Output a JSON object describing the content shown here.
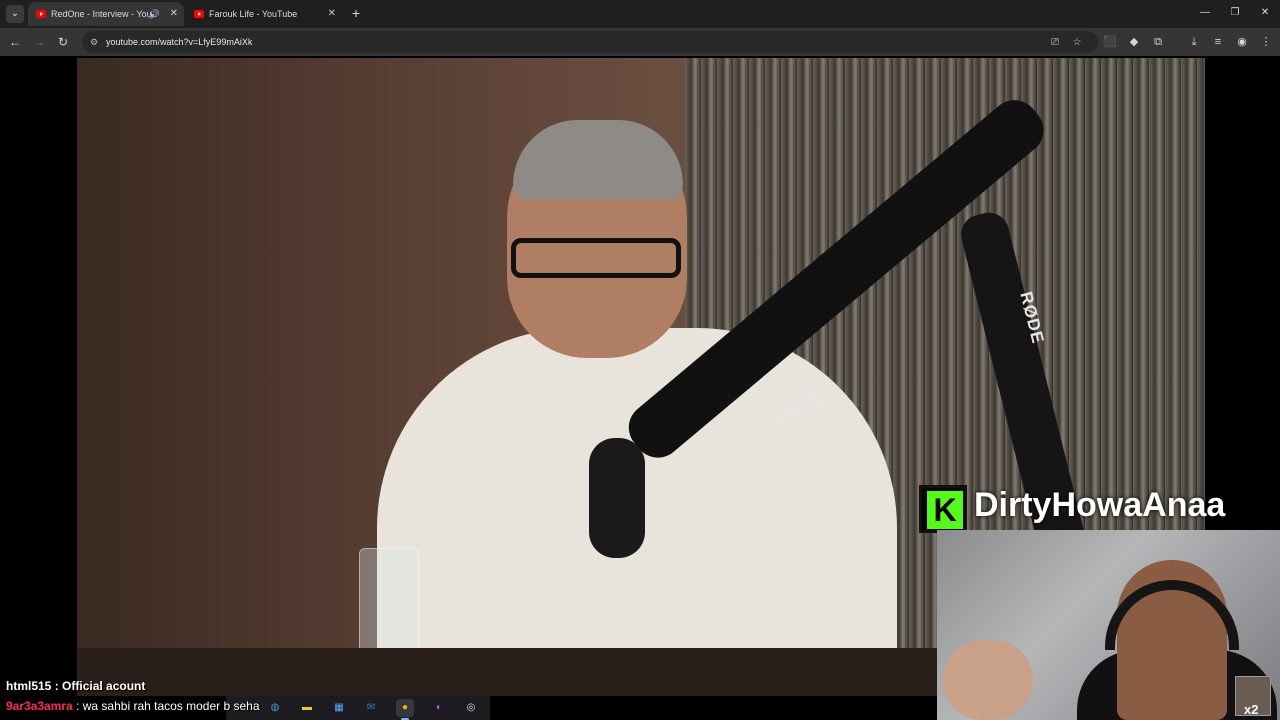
{
  "browser": {
    "tabs": [
      {
        "title": "RedOne - Interview - YouTube",
        "active": true,
        "audio_icon": "speaker-icon"
      },
      {
        "title": "Farouk Life - YouTube",
        "active": false
      }
    ],
    "tab_search_icon": "chevron-down-icon",
    "new_tab_icon": "plus-icon",
    "window_controls": {
      "minimize": "—",
      "restore": "❐",
      "close": "✕"
    },
    "nav": {
      "back": "←",
      "forward": "→",
      "reload": "↻"
    },
    "url": "youtube.com/watch?v=LfyE99mAiXk",
    "omnibox_icons": [
      "cast-icon",
      "star-icon"
    ],
    "toolbar_icons": [
      "translate-icon",
      "extension-diamond-icon",
      "extensions-puzzle-icon",
      "download-icon",
      "reading-list-icon",
      "profile-icon",
      "menu-dots-icon"
    ]
  },
  "video": {
    "microphone_brand_labels": [
      "RØDE",
      "RØDE"
    ]
  },
  "overlay": {
    "brand_letter": "K",
    "brand_color": "#53fc18",
    "channel_name": "DirtyHowaAnaa",
    "webcam_multiplier": "x2"
  },
  "chat": {
    "messages": [
      {
        "user": "html515",
        "separator": " : ",
        "text": "Official acount"
      },
      {
        "user": "9ar3a3amra",
        "separator": " : ",
        "text": "wa sahbi rah tacos moder b seha"
      }
    ]
  },
  "taskbar": {
    "icons": [
      "edge-icon",
      "file-explorer-icon",
      "store-icon",
      "outlook-icon",
      "chrome-icon",
      "messenger-icon",
      "obs-icon"
    ],
    "active_index": 4
  }
}
